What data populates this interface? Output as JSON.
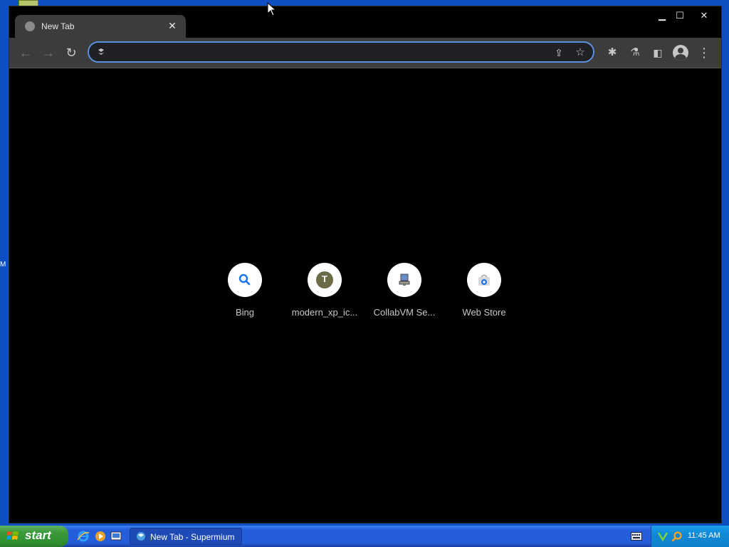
{
  "browser": {
    "tab": {
      "title": "New Tab",
      "close_glyph": "✕"
    },
    "window_controls": {
      "minimize": "▁",
      "maximize": "☐",
      "close": "✕"
    },
    "toolbar": {
      "back_glyph": "←",
      "forward_glyph": "→",
      "reload_glyph": "↻",
      "omnibox_value": "",
      "share_glyph": "⇪",
      "star_glyph": "☆",
      "extensions_glyph": "✱",
      "labs_glyph": "⚗",
      "side_panel_glyph": "◧",
      "menu_glyph": "⋮"
    }
  },
  "shortcuts": [
    {
      "label": "Bing",
      "icon": "search-icon"
    },
    {
      "label": "modern_xp_ic...",
      "icon": "letter-t-icon",
      "letter": "T"
    },
    {
      "label": "CollabVM Se...",
      "icon": "computer-icon"
    },
    {
      "label": "Web Store",
      "icon": "webstore-icon"
    }
  ],
  "taskbar": {
    "start_label": "start",
    "task_button_label": "New Tab - Supermium",
    "clock": "11:45 AM"
  },
  "desktop": {
    "edge_label": "M"
  },
  "colors": {
    "accent": "#5b8fe0",
    "toolbar_bg": "#3c3c3c",
    "content_bg": "#000000",
    "taskbar_blue": "#245edb",
    "start_green": "#3c9a3c"
  }
}
